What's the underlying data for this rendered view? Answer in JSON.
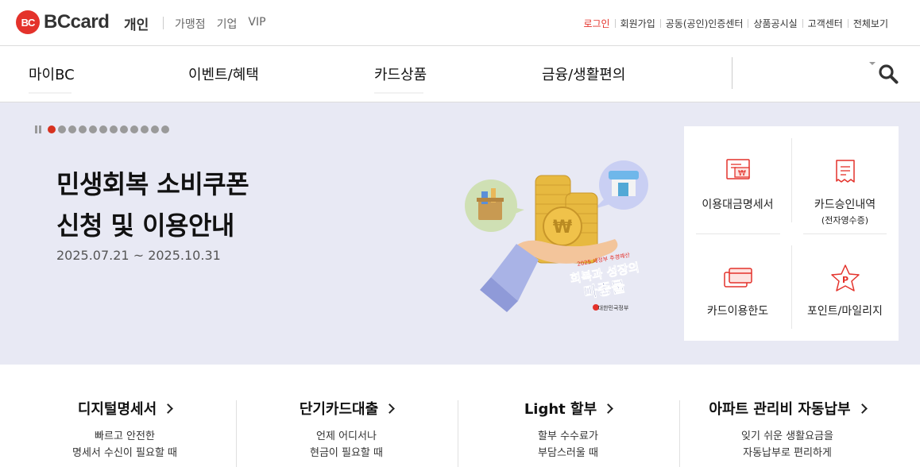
{
  "brand": {
    "logo_mark": "BC",
    "logo_text": "BCcard",
    "site": "개인"
  },
  "site_links": [
    "가맹점",
    "기업",
    "VIP"
  ],
  "util_links": [
    "로그인",
    "회원가입",
    "공동(공인)인증센터",
    "상품공시실",
    "고객센터",
    "전체보기"
  ],
  "gnb": [
    "마이BC",
    "이벤트/혜택",
    "카드상품",
    "금융/생활편의"
  ],
  "search": {
    "icon": "search-icon"
  },
  "hero": {
    "title_line1": "민생회복 소비쿠폰",
    "title_line2": "신청 및 이용안내",
    "date": "2025.07.21 ~ 2025.10.31",
    "slide_count": 12,
    "active_slide": 1,
    "art": {
      "badge_small": "2025 새정부 추경예산",
      "badge_line1": "회복과 성장의",
      "badge_line2": "마중물",
      "gov_label": "대한민국정부",
      "coin_symbol": "₩"
    }
  },
  "quick_menu": [
    {
      "label": "이용대금명세서",
      "sub": "",
      "icon": "bill-statement-icon"
    },
    {
      "label": "카드승인내역",
      "sub": "(전자영수증)",
      "icon": "receipt-icon"
    },
    {
      "label": "카드이용한도",
      "sub": "",
      "icon": "card-limit-icon"
    },
    {
      "label": "포인트/마일리지",
      "sub": "",
      "icon": "point-star-icon"
    }
  ],
  "services": [
    {
      "title": "디지털명세서",
      "desc1": "빠르고 안전한",
      "desc2": "명세서 수신이 필요할 때"
    },
    {
      "title": "단기카드대출",
      "desc1": "언제 어디서나",
      "desc2": "현금이 필요할 때"
    },
    {
      "title": "Light 할부",
      "desc1": "할부 수수료가",
      "desc2": "부담스러울 때"
    },
    {
      "title": "아파트 관리비 자동납부",
      "desc1": "잊기 쉬운 생활요금을",
      "desc2": "자동납부로 편리하게"
    }
  ],
  "colors": {
    "brand_red": "#e4322b",
    "hero_bg": "#e8e9f4",
    "pager_active": "#d7311f"
  }
}
